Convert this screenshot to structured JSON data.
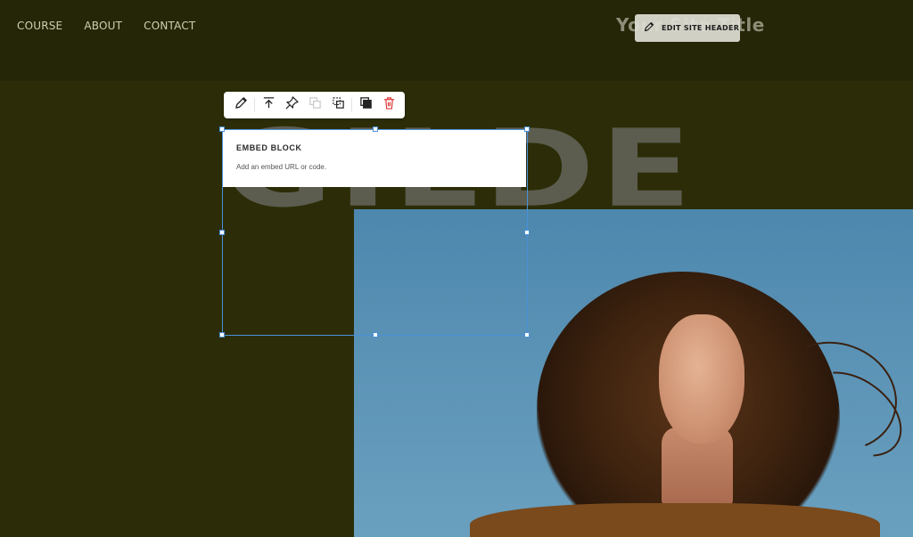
{
  "header": {
    "nav": [
      "COURSE",
      "ABOUT",
      "CONTACT"
    ],
    "site_title": "Your Site Title",
    "edit_header_label": "EDIT SITE HEADER"
  },
  "hero": {
    "background_word": "GILDE"
  },
  "toolbar": {
    "icons": [
      "pencil-icon",
      "move-to-top-icon",
      "pin-icon",
      "send-backward-icon",
      "bring-forward-icon",
      "duplicate-icon",
      "trash-icon"
    ]
  },
  "embed_block": {
    "title": "EMBED BLOCK",
    "subtitle": "Add an embed URL or code."
  },
  "colors": {
    "header_bg": "#252507",
    "content_bg": "#2c2d08",
    "selection": "#4a90d9",
    "delete": "#e03a3a"
  }
}
